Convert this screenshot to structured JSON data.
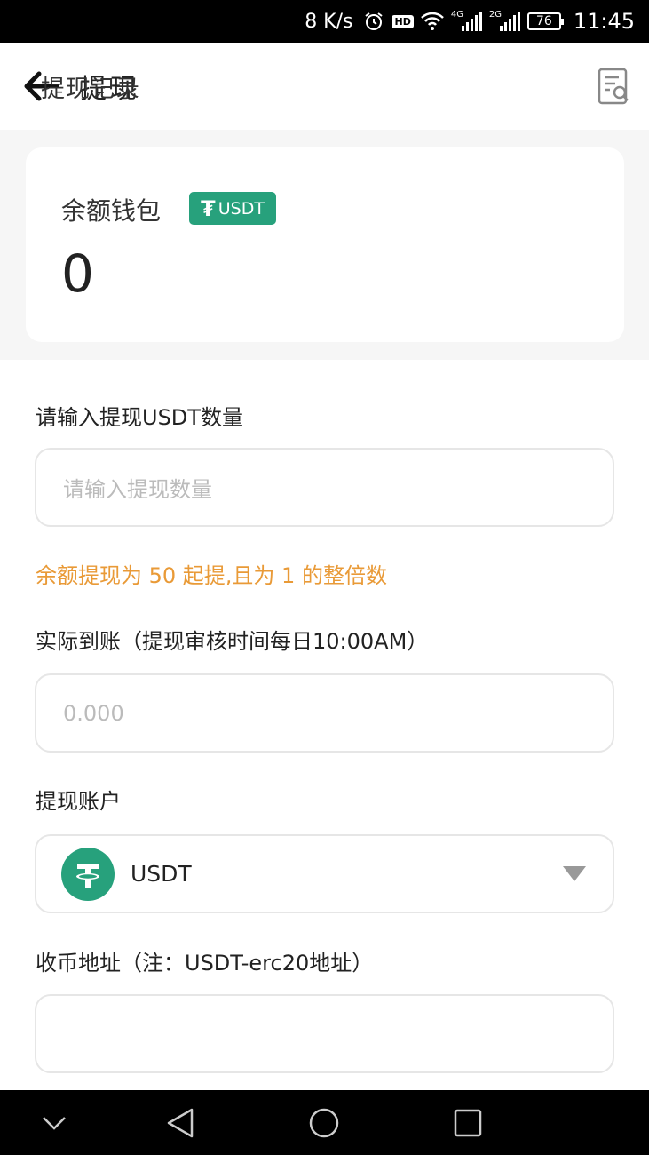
{
  "status_bar": {
    "speed": "8 K/s",
    "hd": "HD",
    "signal1_tag": "4G",
    "signal2_tag": "2G",
    "battery": "76",
    "time": "11:45"
  },
  "header": {
    "title": "提现",
    "record_label": "提现记录"
  },
  "balance_card": {
    "wallet_label": "余额钱包",
    "badge": "USDT",
    "badge_icon": "tether-icon",
    "balance": "0"
  },
  "form": {
    "amount_label": "请输入提现USDT数量",
    "amount_placeholder": "请输入提现数量",
    "amount_value": "",
    "hint": "余额提现为 50 起提,且为 1 的整倍数",
    "actual_label": "实际到账（提现审核时间每日10:00AM）",
    "actual_value": "0.000",
    "account_label": "提现账户",
    "account_selected": "USDT",
    "address_label": "收币地址（注：USDT-erc20地址）",
    "address_value": ""
  },
  "colors": {
    "accent_green": "#27a17c",
    "hint_orange": "#e99a37"
  },
  "nav_bar": {
    "icons": [
      "chevron-down-icon",
      "back-triangle-icon",
      "home-circle-icon",
      "recents-square-icon"
    ]
  }
}
